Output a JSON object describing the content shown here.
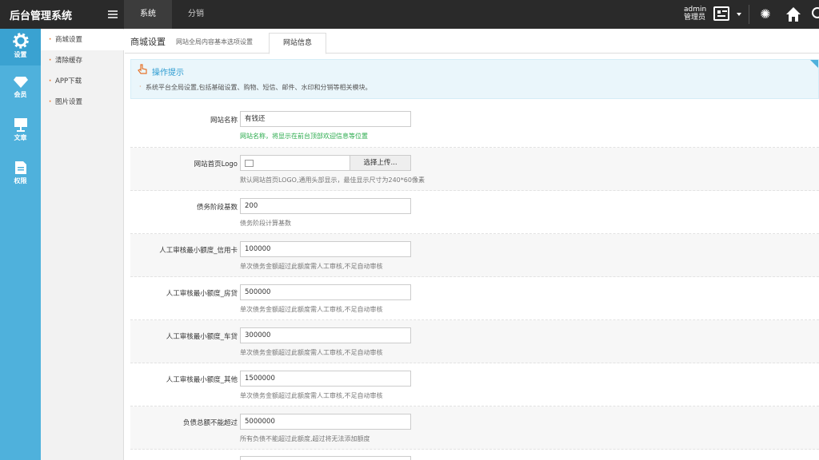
{
  "header": {
    "brand": "后台管理系统",
    "nav": [
      "系统",
      "分销"
    ],
    "user_name": "admin",
    "user_role": "管理员"
  },
  "sidebar": {
    "items": [
      {
        "label": "设置",
        "icon": "gear-icon"
      },
      {
        "label": "会员",
        "icon": "diamond-icon"
      },
      {
        "label": "文章",
        "icon": "article-icon"
      },
      {
        "label": "权限",
        "icon": "document-icon"
      }
    ]
  },
  "subnav": {
    "items": [
      "商城设置",
      "清除缓存",
      "APP下载",
      "图片设置"
    ]
  },
  "page": {
    "title": "商城设置",
    "subtitle": "网站全局内容基本选项设置",
    "tab": "网站信息"
  },
  "tips": {
    "title": "操作提示",
    "text": "系统平台全局设置,包括基础设置、购物、短信、邮件、水印和分销等相关模块。"
  },
  "form": {
    "fields": [
      {
        "label": "网站名称",
        "value": "有钱还",
        "hint": "网站名称，将显示在前台顶部欢迎信息等位置"
      },
      {
        "label": "网站首页Logo",
        "button": "选择上传...",
        "hint": "默认网站首页LOGO,通用头部显示，最佳显示尺寸为240*60像素"
      },
      {
        "label": "债务阶段基数",
        "value": "200",
        "hint": "债务阶段计算基数"
      },
      {
        "label": "人工审核最小额度_信用卡",
        "value": "100000",
        "hint": "单次债务金额超过此额度需人工审核,不足自动审核"
      },
      {
        "label": "人工审核最小额度_房贷",
        "value": "500000",
        "hint": "单次债务金额超过此额度需人工审核,不足自动审核"
      },
      {
        "label": "人工审核最小额度_车贷",
        "value": "300000",
        "hint": "单次债务金额超过此额度需人工审核,不足自动审核"
      },
      {
        "label": "人工审核最小额度_其他",
        "value": "1500000",
        "hint": "单次债务金额超过此额度需人工审核,不足自动审核"
      },
      {
        "label": "负债总额不能超过",
        "value": "5000000",
        "hint": "所有负债不能超过此额度,超过将无法添加额度"
      }
    ]
  },
  "colors": {
    "sidebar": "#4fb1dc",
    "topbar": "#2a2a2a",
    "hint_green": "#2bab4d",
    "tips_bg": "#eaf6fb"
  }
}
